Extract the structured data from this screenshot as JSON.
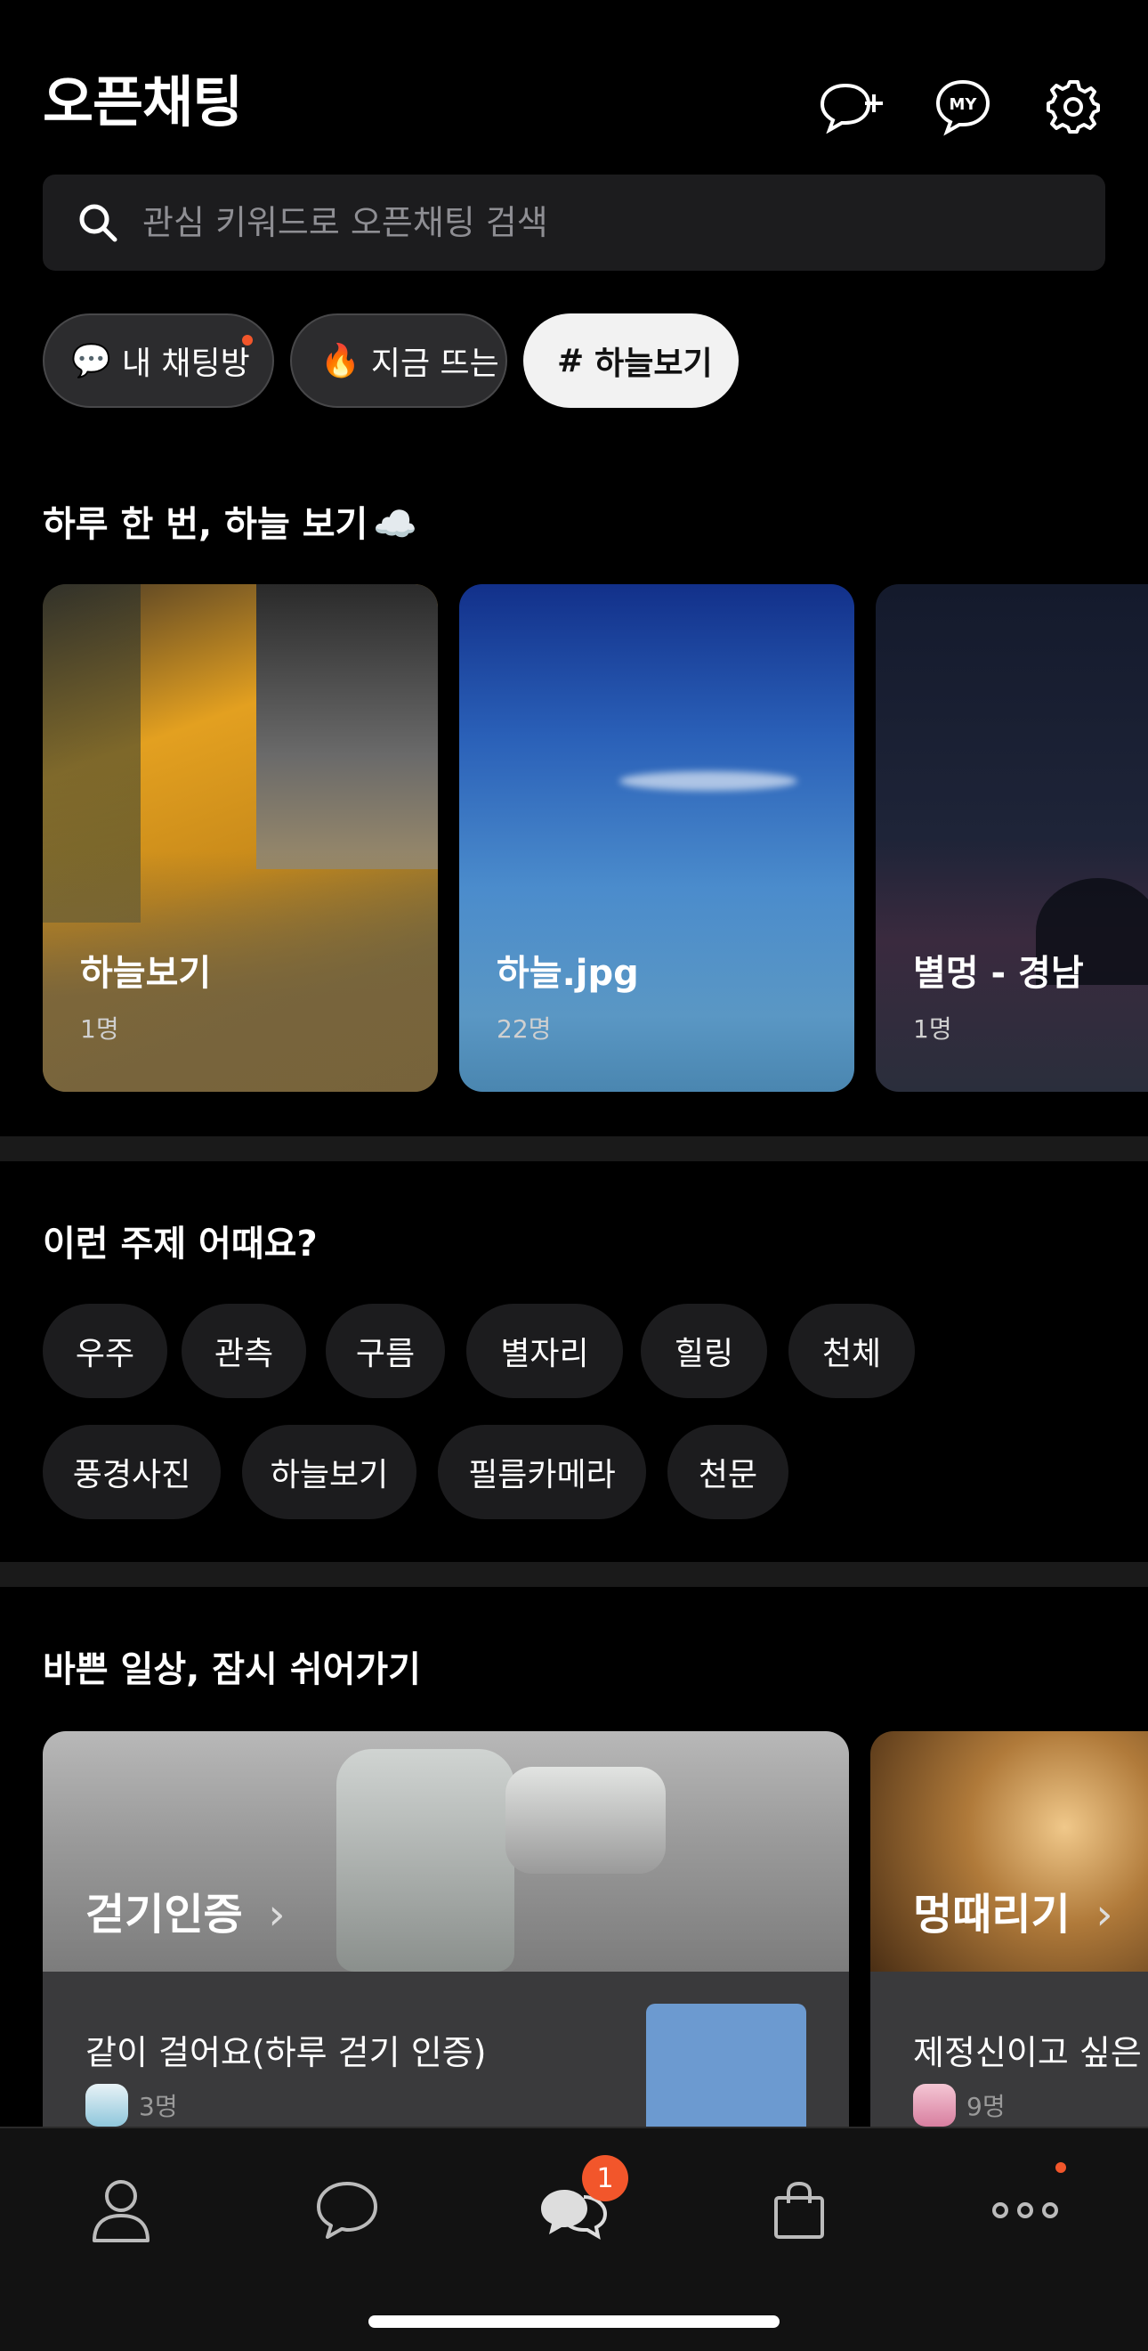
{
  "header": {
    "title": "오픈채팅"
  },
  "header_icons": [
    "add-chat-icon",
    "my-profile-icon",
    "settings-icon"
  ],
  "my_badge": "MY",
  "search": {
    "placeholder": "관심 키워드로 오픈채팅 검색"
  },
  "chips": [
    {
      "emoji": "💬",
      "label": "내 채팅방",
      "has_dot": true
    },
    {
      "emoji": "🔥",
      "label": "지금 뜨는"
    },
    {
      "emoji": "#",
      "label": "하늘보기",
      "selected": true
    }
  ],
  "section1": {
    "title": "하루 한 번, 하늘 보기",
    "emoji": "☁️",
    "cards": [
      {
        "name": "하늘보기",
        "members": "1명"
      },
      {
        "name": "하늘.jpg",
        "members": "22명"
      },
      {
        "name": "별멍 - 경남",
        "members": "1명"
      }
    ]
  },
  "section2": {
    "title": "이런 주제 어때요?",
    "tags_row1": [
      "우주",
      "관측",
      "구름",
      "별자리",
      "힐링",
      "천체"
    ],
    "tags_row2": [
      "풍경사진",
      "하늘보기",
      "필름카메라",
      "천문"
    ]
  },
  "section3": {
    "title": "바쁜 일상, 잠시 쉬어가기",
    "cards": [
      {
        "category": "걷기인증",
        "room": "같이 걸어요(하루 걷기 인증)",
        "members": "3명"
      },
      {
        "category": "멍때리기",
        "room": "제정신이고 싶은 사",
        "members": "9명"
      }
    ]
  },
  "bottom_nav": {
    "items": [
      "friends-icon",
      "chats-icon",
      "openchat-icon",
      "shopping-icon",
      "more-icon"
    ],
    "openchat_badge": "1"
  },
  "colors": {
    "accent": "#f2562b",
    "background": "#000000"
  }
}
